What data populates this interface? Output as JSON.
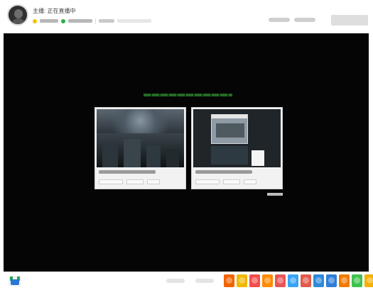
{
  "header": {
    "title": "主播: 正在直播中",
    "meta": [
      "",
      "",
      "",
      ""
    ],
    "right_links": [
      "",
      ""
    ],
    "action_button": ""
  },
  "stage": {
    "title": "",
    "cards": [
      {
        "label": "",
        "actions": [
          "",
          "",
          ""
        ]
      },
      {
        "label": "",
        "actions": [
          "",
          "",
          ""
        ]
      }
    ],
    "link": ""
  },
  "bottom": {
    "tabs": [
      "",
      ""
    ],
    "gifts": [
      {
        "icon": "gift-icon",
        "color": "#f16300"
      },
      {
        "icon": "gift-icon",
        "color": "#f2b800"
      },
      {
        "icon": "gift-icon",
        "color": "#f44d4d"
      },
      {
        "icon": "gift-icon",
        "color": "#ff8a00"
      },
      {
        "icon": "gift-icon",
        "color": "#e95555"
      },
      {
        "icon": "gift-icon",
        "color": "#36a3f7"
      },
      {
        "icon": "gift-icon",
        "color": "#e05a4c"
      },
      {
        "icon": "gift-icon",
        "color": "#2f89d9"
      },
      {
        "icon": "gift-icon",
        "color": "#2f7ed8"
      },
      {
        "icon": "gift-icon",
        "color": "#f07b00"
      },
      {
        "icon": "gift-icon",
        "color": "#3ec34f"
      },
      {
        "icon": "gift-icon",
        "color": "#f4b000"
      }
    ]
  },
  "colors": {
    "stage_background": "#050505",
    "live_green": "#2bb04a",
    "highlight_yellow": "#f2c200"
  }
}
